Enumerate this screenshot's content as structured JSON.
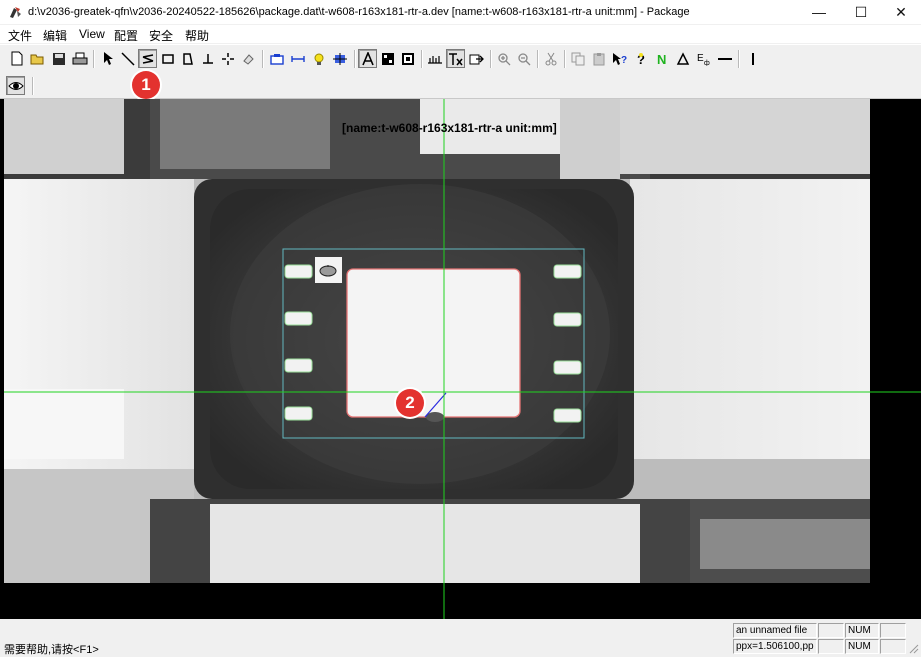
{
  "window": {
    "title": "d:\\v2036-greatek-qfn\\v2036-20240522-185626\\package.dat\\t-w608-r163x181-rtr-a.dev [name:t-w608-r163x181-rtr-a unit:mm] - Package",
    "minimize_glyph": "—",
    "maximize_glyph": "☐",
    "close_glyph": "✕"
  },
  "menu": {
    "items": [
      "文件",
      "编辑",
      "View",
      "配置",
      "安全",
      "帮助"
    ]
  },
  "toolbar": {
    "buttons": [
      "new-icon",
      "open-icon",
      "save-icon",
      "print-icon",
      "select-arrow-icon",
      "line-tool-icon",
      "polyline-tool-icon",
      "rectangle-tool-icon",
      "lead-tool-icon",
      "baseline-tool-icon",
      "crosshair-tool-icon",
      "eraser-icon",
      "camera-icon",
      "measure-icon",
      "light-icon",
      "blob-icon",
      "text-a-icon",
      "grid-pattern-icon",
      "grid-pattern2-icon",
      "level-icon",
      "text-tx-icon",
      "export-icon",
      "zoom-in-icon",
      "zoom-out-icon",
      "cut-icon",
      "copy-icon",
      "paste-icon",
      "help-cursor-icon",
      "help-icon",
      "n-letter-icon",
      "delta-icon",
      "e-sub-icon",
      "horizontal-line-icon",
      "vertical-line-icon"
    ],
    "selected": "polyline-tool-icon"
  },
  "toolbar2": {
    "buttons": [
      "eye-icon"
    ]
  },
  "markers": {
    "one": "1",
    "two": "2"
  },
  "canvas": {
    "overlay_label": "[name:t-w608-r163x181-rtr-a unit:mm]",
    "crosshair_color": "#1fd31f",
    "roi_color": "#62b8c0",
    "die_color": "#e57373",
    "measure_color": "#2a2ae0"
  },
  "status": {
    "message": "需要帮助,请按<F1>",
    "file": "an unnamed file",
    "num1": "NUM",
    "num2": "NUM",
    "ppx": "ppx=1.506100,pp"
  }
}
